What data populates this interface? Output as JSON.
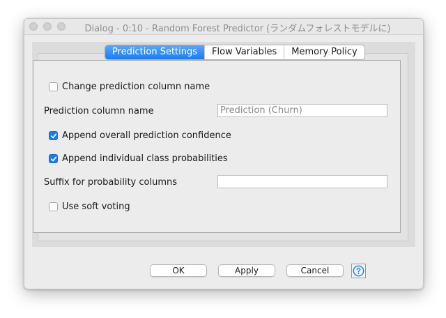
{
  "window": {
    "title": "Dialog - 0:10 - Random Forest Predictor (ランダムフォレストモデルに)"
  },
  "tabs": [
    {
      "label": "Prediction Settings",
      "active": true
    },
    {
      "label": "Flow Variables",
      "active": false
    },
    {
      "label": "Memory Policy",
      "active": false
    }
  ],
  "settings": {
    "change_column_name": {
      "label": "Change prediction column name",
      "checked": false
    },
    "prediction_column_label": "Prediction column name",
    "prediction_column_value": "Prediction (Churn)",
    "append_confidence": {
      "label": "Append overall prediction confidence",
      "checked": true
    },
    "append_class_probs": {
      "label": "Append individual class probabilities",
      "checked": true
    },
    "suffix_label": "Suffix for probability columns",
    "suffix_value": "",
    "soft_voting": {
      "label": "Use soft voting",
      "checked": false
    }
  },
  "buttons": {
    "ok": "OK",
    "apply": "Apply",
    "cancel": "Cancel",
    "help_icon": "question-circle-icon"
  },
  "colors": {
    "accent": "#1a7cf5",
    "help": "#1a7cf5"
  }
}
